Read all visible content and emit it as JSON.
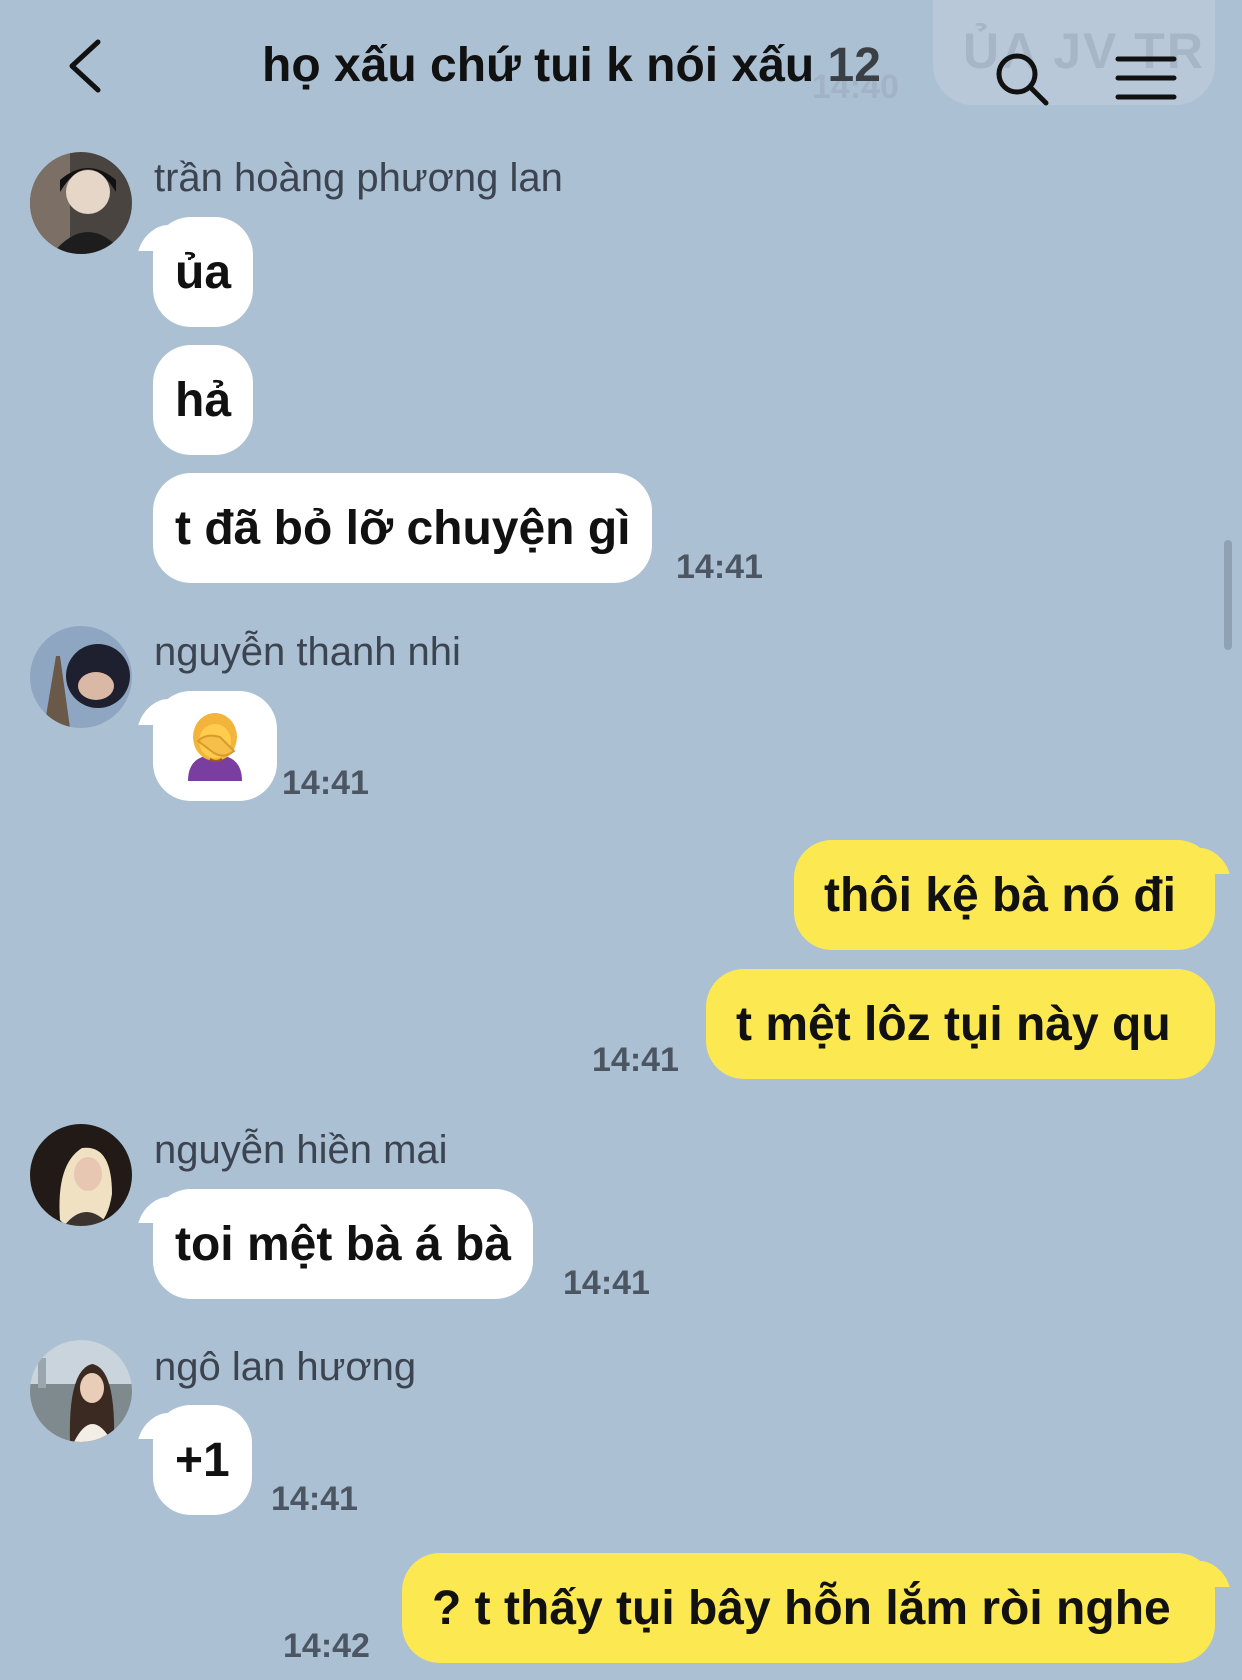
{
  "header": {
    "title": "họ xấu chứ tui k nói xấu",
    "member_count": "12",
    "overlay_text": "ỦA JV TR",
    "overlay_time": "14:40"
  },
  "messages": [
    {
      "sender": "trần hoàng phương lan",
      "bubbles": [
        "ủa",
        "hả",
        "t đã bỏ lỡ chuyện gì"
      ],
      "time": "14:41"
    },
    {
      "sender": "nguyễn thanh nhi",
      "emoji": "woman-facepalming-icon",
      "time": "14:41"
    },
    {
      "outgoing": true,
      "bubbles": [
        "thôi kệ bà nó đi",
        "t mệt lôz tụi này qu"
      ],
      "time": "14:41"
    },
    {
      "sender": "nguyễn hiền mai",
      "bubbles": [
        "toi mệt bà á bà"
      ],
      "time": "14:41"
    },
    {
      "sender": "ngô lan hương",
      "bubbles": [
        "+1"
      ],
      "time": "14:41"
    },
    {
      "outgoing": true,
      "bubbles": [
        "? t thấy tụi bây hỗn lắm ròi nghe"
      ],
      "time": "14:42"
    }
  ],
  "colors": {
    "background": "#acc0d3",
    "incoming_bubble": "#ffffff",
    "outgoing_bubble": "#fce951"
  }
}
